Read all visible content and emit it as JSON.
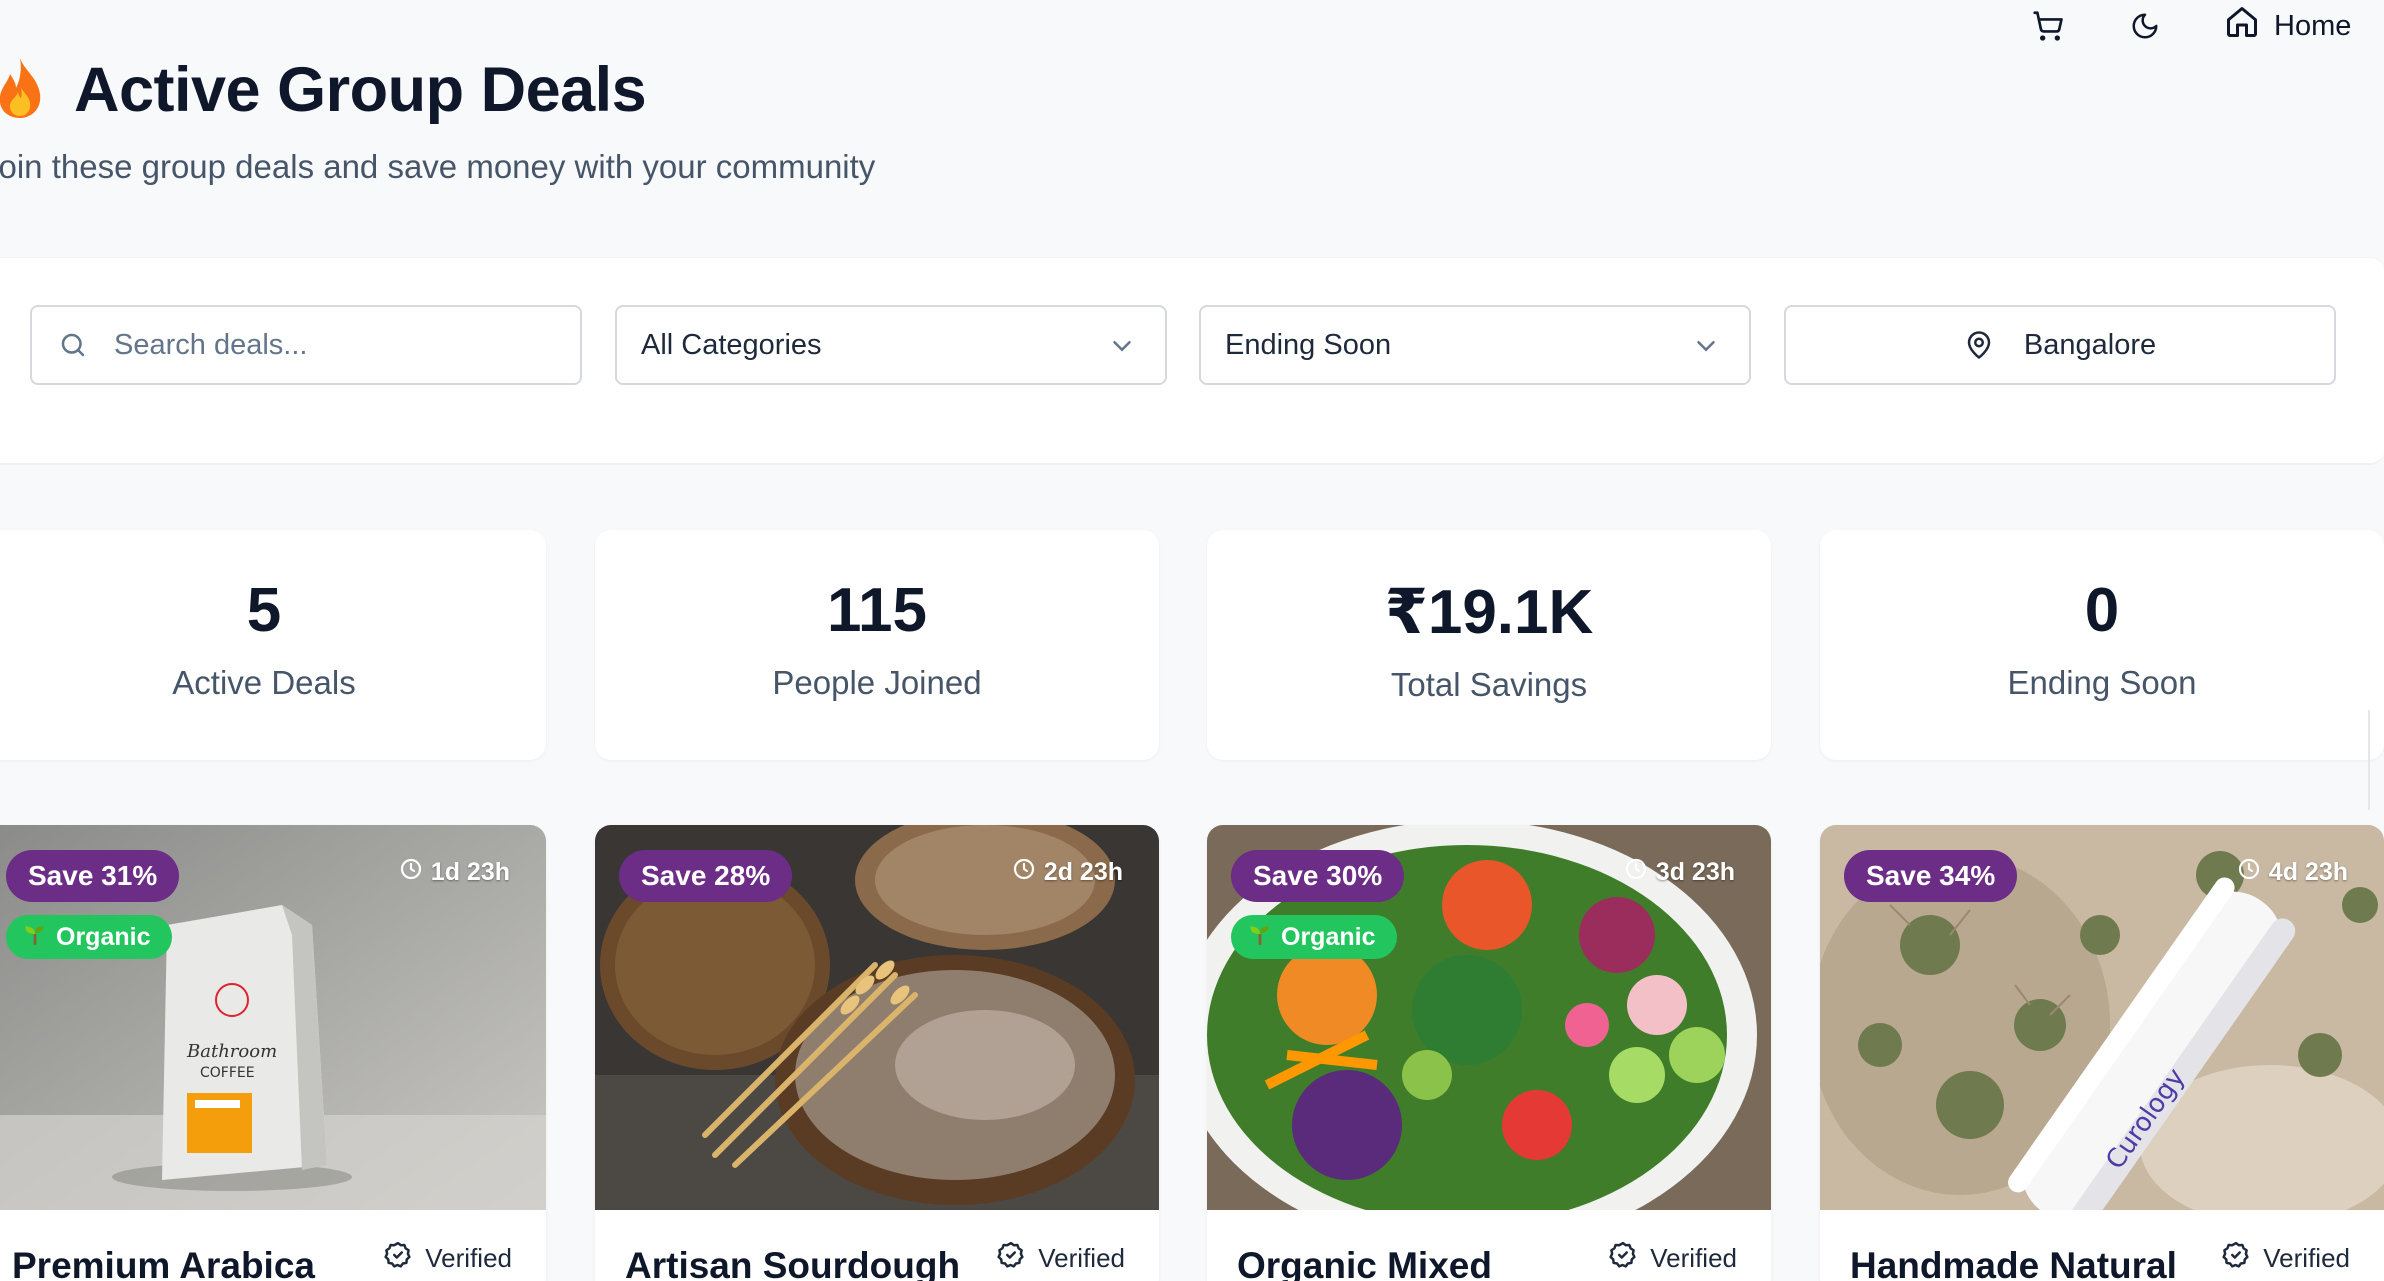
{
  "nav": {
    "cart_icon": "cart-icon",
    "theme_icon": "moon-icon",
    "home_label": "Home"
  },
  "header": {
    "title": "Active Group Deals",
    "subtitle": "Join these group deals and save money with your community"
  },
  "filters": {
    "search_placeholder": "Search deals...",
    "category": "All Categories",
    "sort": "Ending Soon",
    "location": "Bangalore"
  },
  "stats": [
    {
      "value": "5",
      "label": "Active Deals"
    },
    {
      "value": "115",
      "label": "People Joined"
    },
    {
      "value": "₹19.1K",
      "label": "Total Savings"
    },
    {
      "value": "0",
      "label": "Ending Soon"
    }
  ],
  "deals": [
    {
      "save": "Save 31%",
      "time": "1d 23h",
      "organic": "Organic",
      "title": "Premium Arabica",
      "verified": "Verified",
      "image": "coffee-bag-photo"
    },
    {
      "save": "Save 28%",
      "time": "2d 23h",
      "title": "Artisan Sourdough",
      "verified": "Verified",
      "image": "bread-photo"
    },
    {
      "save": "Save 30%",
      "time": "3d 23h",
      "organic": "Organic",
      "title": "Organic Mixed",
      "verified": "Verified",
      "image": "salad-photo"
    },
    {
      "save": "Save 34%",
      "time": "4d 23h",
      "title": "Handmade Natural",
      "verified": "Verified",
      "image": "curology-tube-photo"
    }
  ],
  "colors": {
    "save_badge": "#6b2d86",
    "organic_badge": "#22c55e",
    "title": "#0f172a",
    "muted": "#475569"
  }
}
